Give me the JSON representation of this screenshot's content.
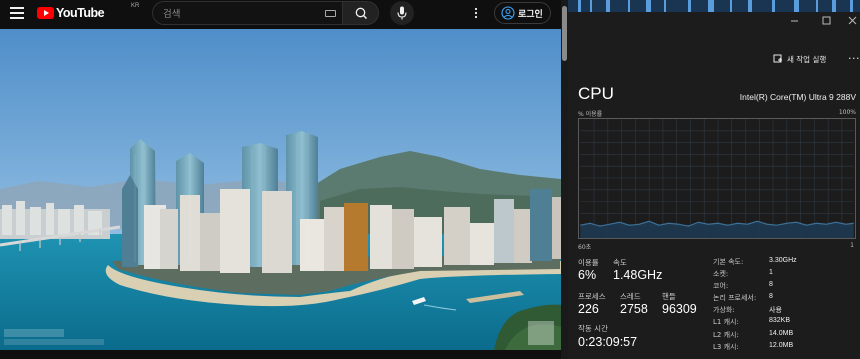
{
  "youtube": {
    "logo_text": "YouTube",
    "region": "KR",
    "search_placeholder": "검색",
    "login_label": "로그인",
    "icons": [
      "menu-icon",
      "youtube-logo",
      "keyboard-icon",
      "search-icon",
      "mic-icon",
      "more-vert-icon",
      "account-icon"
    ]
  },
  "task_manager": {
    "new_task_label": "새 작업 실행",
    "more_label": "···",
    "title": "CPU",
    "model": "Intel(R) Core(TM) Ultra 9 288V",
    "usage_axis_label": "% 이용률",
    "usage_axis_max": "100%",
    "time_axis_label": "60초",
    "time_axis_end": "1",
    "graph_line_color": "#3c6e96",
    "stats": {
      "utilization": {
        "label": "이용률",
        "value": "6%"
      },
      "speed": {
        "label": "속도",
        "value": "1.48GHz"
      },
      "processes": {
        "label": "프로세스",
        "value": "226"
      },
      "threads": {
        "label": "스레드",
        "value": "2758"
      },
      "handles": {
        "label": "핸들",
        "value": "96309"
      },
      "uptime": {
        "label": "작동 시간",
        "value": "0:23:09:57"
      }
    },
    "specs": [
      {
        "key": "기본 속도:",
        "value": "3.30GHz"
      },
      {
        "key": "소켓:",
        "value": "1"
      },
      {
        "key": "코어:",
        "value": "8"
      },
      {
        "key": "논리 프로세서:",
        "value": "8"
      },
      {
        "key": "가상화:",
        "value": "사용"
      },
      {
        "key": "L1 캐시:",
        "value": "832KB"
      },
      {
        "key": "L2 캐시:",
        "value": "14.0MB"
      },
      {
        "key": "L3 캐시:",
        "value": "12.0MB"
      }
    ]
  }
}
